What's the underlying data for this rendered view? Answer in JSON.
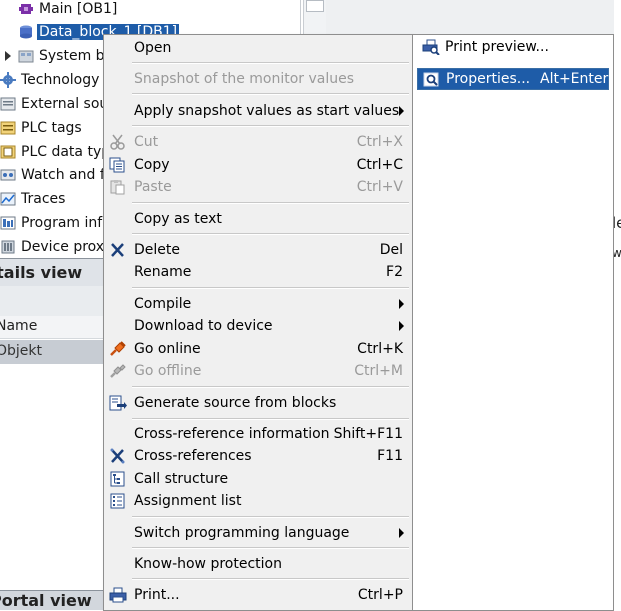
{
  "tree": {
    "items": [
      {
        "label": "Main [OB1]",
        "icon": "block-ob-icon"
      },
      {
        "label": "Data_block_1 [DB1]",
        "icon": "database-icon",
        "selected": true
      },
      {
        "label": "System b",
        "icon": "system-blocks-icon"
      },
      {
        "label": "Technology o",
        "icon": "technology-icon"
      },
      {
        "label": "External sou",
        "icon": "external-source-icon"
      },
      {
        "label": "PLC tags",
        "icon": "plc-tags-icon"
      },
      {
        "label": "PLC data typ",
        "icon": "plc-data-types-icon"
      },
      {
        "label": "Watch and fo",
        "icon": "watch-tables-icon"
      },
      {
        "label": "Traces",
        "icon": "traces-icon"
      },
      {
        "label": "Program info",
        "icon": "program-info-icon"
      },
      {
        "label": "Device proxy",
        "icon": "device-proxy-icon"
      }
    ]
  },
  "details": {
    "header": "Details view",
    "column_label": "Name",
    "selected_value": "Objekt",
    "bottom_header": "Portal view"
  },
  "right_fragments": {
    "frag1": "le",
    "frag2": "w"
  },
  "context_menu": {
    "items": [
      {
        "label": "Open",
        "shortcut": "",
        "icon": "",
        "disabled": false,
        "submenu": false
      },
      {
        "label": "Snapshot of the monitor values",
        "shortcut": "",
        "icon": "",
        "disabled": true,
        "submenu": false
      },
      {
        "label": "Apply snapshot values as start values",
        "shortcut": "",
        "icon": "",
        "disabled": false,
        "submenu": true
      },
      {
        "label": "Cut",
        "shortcut": "Ctrl+X",
        "icon": "scissors-icon",
        "disabled": true,
        "submenu": false
      },
      {
        "label": "Copy",
        "shortcut": "Ctrl+C",
        "icon": "copy-icon",
        "disabled": false,
        "submenu": false
      },
      {
        "label": "Paste",
        "shortcut": "Ctrl+V",
        "icon": "paste-icon",
        "disabled": true,
        "submenu": false
      },
      {
        "label": "Copy as text",
        "shortcut": "",
        "icon": "",
        "disabled": false,
        "submenu": false
      },
      {
        "label": "Delete",
        "shortcut": "Del",
        "icon": "delete-x-icon",
        "disabled": false,
        "submenu": false
      },
      {
        "label": "Rename",
        "shortcut": "F2",
        "icon": "",
        "disabled": false,
        "submenu": false
      },
      {
        "label": "Compile",
        "shortcut": "",
        "icon": "",
        "disabled": false,
        "submenu": true
      },
      {
        "label": "Download to device",
        "shortcut": "",
        "icon": "",
        "disabled": false,
        "submenu": true
      },
      {
        "label": "Go online",
        "shortcut": "Ctrl+K",
        "icon": "go-online-icon",
        "disabled": false,
        "submenu": false
      },
      {
        "label": "Go offline",
        "shortcut": "Ctrl+M",
        "icon": "go-offline-icon",
        "disabled": true,
        "submenu": false
      },
      {
        "label": "Generate source from blocks",
        "shortcut": "",
        "icon": "generate-source-icon",
        "disabled": false,
        "submenu": false
      },
      {
        "label": "Cross-reference information",
        "shortcut": "Shift+F11",
        "icon": "",
        "disabled": false,
        "submenu": false
      },
      {
        "label": "Cross-references",
        "shortcut": "F11",
        "icon": "cross-references-icon",
        "disabled": false,
        "submenu": false
      },
      {
        "label": "Call structure",
        "shortcut": "",
        "icon": "call-structure-icon",
        "disabled": false,
        "submenu": false
      },
      {
        "label": "Assignment list",
        "shortcut": "",
        "icon": "assignment-list-icon",
        "disabled": false,
        "submenu": false
      },
      {
        "label": "Switch programming language",
        "shortcut": "",
        "icon": "",
        "disabled": false,
        "submenu": true
      },
      {
        "label": "Know-how protection",
        "shortcut": "",
        "icon": "",
        "disabled": false,
        "submenu": false
      },
      {
        "label": "Print...",
        "shortcut": "Ctrl+P",
        "icon": "printer-icon",
        "disabled": false,
        "submenu": false
      }
    ]
  },
  "secondary_menu": {
    "items": [
      {
        "label": "Print preview...",
        "shortcut": "",
        "icon": "print-preview-icon",
        "highlighted": false
      },
      {
        "label": "Properties...",
        "shortcut": "Alt+Enter",
        "icon": "properties-icon",
        "highlighted": true
      }
    ]
  },
  "colors": {
    "selection": "#1e5ca8",
    "menu_bg": "#f0f0f0",
    "disabled_text": "#9a9a9a"
  }
}
